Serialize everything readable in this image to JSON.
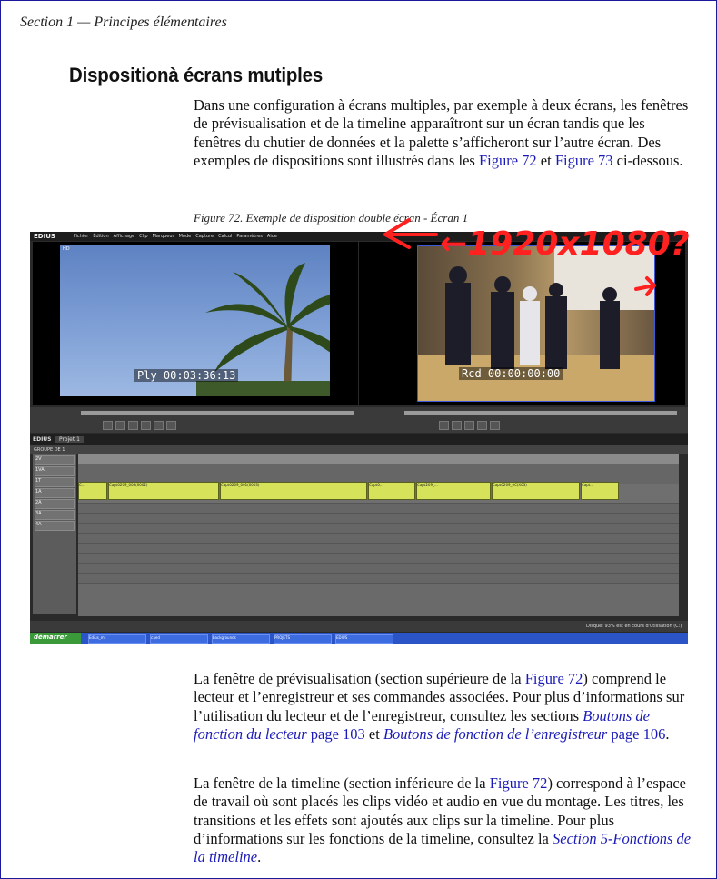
{
  "header": {
    "section": "Section 1 — Principes élémentaires"
  },
  "heading": "Dispositionà écrans mutiples",
  "intro": {
    "t1": "Dans une configuration à écrans multiples, par exemple à deux écrans, les fenêtres de prévisualisation et de la timeline apparaîtront sur un écran tandis que les fenêtres du chutier de données et la palette s’afficheront sur l’autre écran. Des exemples de dispositions sont illustrés dans les ",
    "l1": "Figure 72",
    "t2": " et ",
    "l2": "Figure 73",
    "t3": " ci-dessous."
  },
  "figure": {
    "caption": "Figure 72.  Exemple de disposition double écran - Écran 1",
    "annotation": "←1920x1080?",
    "screenshot": {
      "app_logo": "EDIUS",
      "menus": [
        "Fichier",
        "Édition",
        "Affichage",
        "Clip",
        "Marqueur",
        "Mode",
        "Capture",
        "Calcul",
        "Paramètres",
        "Aide"
      ],
      "player_tc": "Ply 00:03:36:13",
      "recorder_tc": "Rcd 00:00:00:00",
      "hd_badge": "HD",
      "tl_title": "EDIUS",
      "project": "Projet 1",
      "sequence": "GROUPE DE 1",
      "tracks": [
        "2V",
        "1VA",
        "1T",
        "1A",
        "2A",
        "3A",
        "4A"
      ],
      "clips": [
        "C...",
        "Capt0209_003(0002)",
        "Capt0209_001(0003)",
        "Capt0...",
        "Capt209_...",
        "Capt0209_0C(X03)",
        "Capt..."
      ],
      "status": "Disque: 93% est en cours d'utilisation (C:)",
      "start": "démarrer",
      "tasks": [
        "Edius_mt",
        "c:\\ed",
        "backgrounds",
        "PROJETS",
        "EDIUS"
      ]
    }
  },
  "para2": {
    "t1": "La fenêtre de prévisualisation (section supérieure de la ",
    "l1": "Figure 72",
    "t2": ") comprend le lecteur et l’enregistreur et ses commandes associées. Pour plus d’informations sur l’utilisation du lecteur et de l’enregistreur, consultez les sections ",
    "l2": "Boutons de fonction du lecteur",
    "l2b": " page 103",
    "t3": " et ",
    "l3": "Boutons de fonction de l’enregistreur",
    "l3b": " page 106",
    "t4": "."
  },
  "para3": {
    "t1": "La fenêtre de la timeline (section inférieure de la ",
    "l1": "Figure 72",
    "t2": ") correspond à l’espace de travail où sont placés les clips vidéo et audio en vue du montage. Les titres, les transitions et les effets sont ajoutés aux clips sur la timeline. Pour plus d’informations sur les fonctions de la timeline, consultez la ",
    "l2": "Section 5-Fonctions de la timeline",
    "t3": "."
  },
  "colors": {
    "link": "#1a1ab8",
    "annotation": "#ff2020"
  }
}
